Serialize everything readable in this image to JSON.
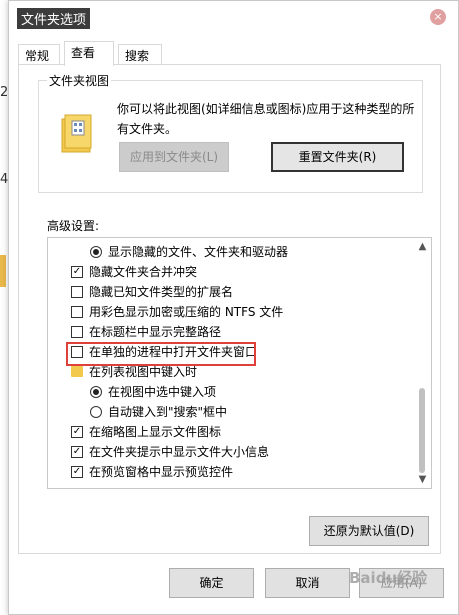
{
  "background": {
    "chars": [
      "2",
      "4"
    ]
  },
  "window": {
    "title": "文件夹选项",
    "close_glyph": "×"
  },
  "tabs": [
    {
      "label": "常规",
      "active": false
    },
    {
      "label": "查看",
      "active": true
    },
    {
      "label": "搜索",
      "active": false
    }
  ],
  "folder_view": {
    "group_label": "文件夹视图",
    "description": "你可以将此视图(如详细信息或图标)应用于这种类型的所有文件夹。",
    "apply_button": "应用到文件夹(L)",
    "reset_button": "重置文件夹(R)"
  },
  "advanced": {
    "label": "高级设置:",
    "items": [
      {
        "type": "radio",
        "checked": true,
        "label": "显示隐藏的文件、文件夹和驱动器"
      },
      {
        "type": "checkbox",
        "checked": true,
        "label": "隐藏文件夹合并冲突"
      },
      {
        "type": "checkbox",
        "checked": false,
        "label": "隐藏已知文件类型的扩展名",
        "highlighted": true
      },
      {
        "type": "checkbox",
        "checked": false,
        "label": "用彩色显示加密或压缩的 NTFS 文件"
      },
      {
        "type": "checkbox",
        "checked": false,
        "label": "在标题栏中显示完整路径"
      },
      {
        "type": "checkbox",
        "checked": false,
        "label": "在单独的进程中打开文件夹窗口"
      },
      {
        "type": "folder",
        "label": "在列表视图中键入时"
      },
      {
        "type": "radio",
        "checked": true,
        "label": "在视图中选中键入项"
      },
      {
        "type": "radio",
        "checked": false,
        "label": "自动键入到\"搜索\"框中"
      },
      {
        "type": "checkbox",
        "checked": true,
        "label": "在缩略图上显示文件图标"
      },
      {
        "type": "checkbox",
        "checked": true,
        "label": "在文件夹提示中显示文件大小信息"
      },
      {
        "type": "checkbox",
        "checked": true,
        "label": "在预览窗格中显示预览控件"
      }
    ]
  },
  "restore_button": "还原为默认值(D)",
  "footer": {
    "ok": "确定",
    "cancel": "取消",
    "apply": "应用(A)"
  },
  "watermark": "Baidu经验",
  "colors": {
    "highlight": "#e0403a",
    "folder": "#f2c94c"
  }
}
